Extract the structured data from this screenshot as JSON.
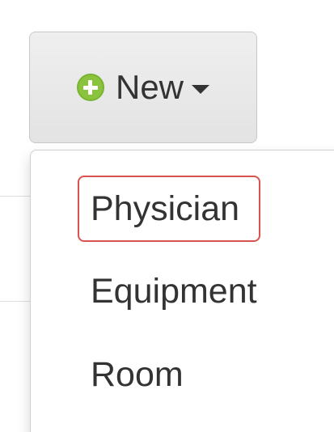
{
  "new_button": {
    "label": "New",
    "icon": "plus-circle-icon",
    "dropdown_icon": "caret-down-icon",
    "icon_color": "#8ac43f"
  },
  "menu": {
    "items": [
      {
        "label": "Physician",
        "highlighted": true,
        "highlight_color": "#d9534f"
      },
      {
        "label": "Equipment"
      },
      {
        "label": "Room"
      }
    ]
  }
}
